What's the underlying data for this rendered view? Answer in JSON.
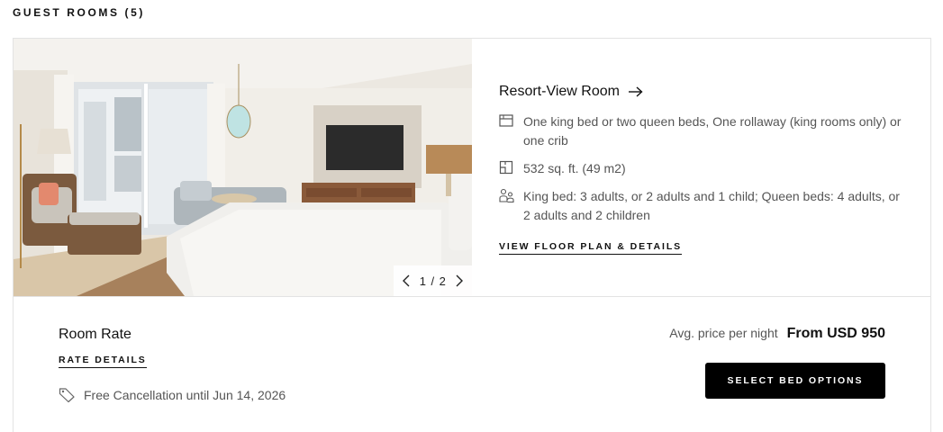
{
  "section": {
    "title": "GUEST ROOMS (5)"
  },
  "room": {
    "name": "Resort-View Room",
    "features": [
      {
        "icon": "bed-icon",
        "text": "One king bed or two queen beds, One rollaway (king rooms only) or one crib"
      },
      {
        "icon": "floor-plan-icon",
        "text": "532 sq. ft. (49 m2)"
      },
      {
        "icon": "guests-icon",
        "text": "King bed: 3 adults, or 2 adults and 1 child; Queen beds: 4 adults, or 2 adults and 2 children"
      }
    ],
    "floor_plan_link": "VIEW FLOOR PLAN & DETAILS"
  },
  "gallery": {
    "current": "1",
    "separator": "/",
    "total": "2"
  },
  "rate": {
    "title": "Room Rate",
    "details_link": "RATE DETAILS",
    "cancellation": "Free Cancellation until Jun 14, 2026",
    "avg_label": "Avg. price per night",
    "price": "From USD 950",
    "select_button": "SELECT BED OPTIONS"
  }
}
